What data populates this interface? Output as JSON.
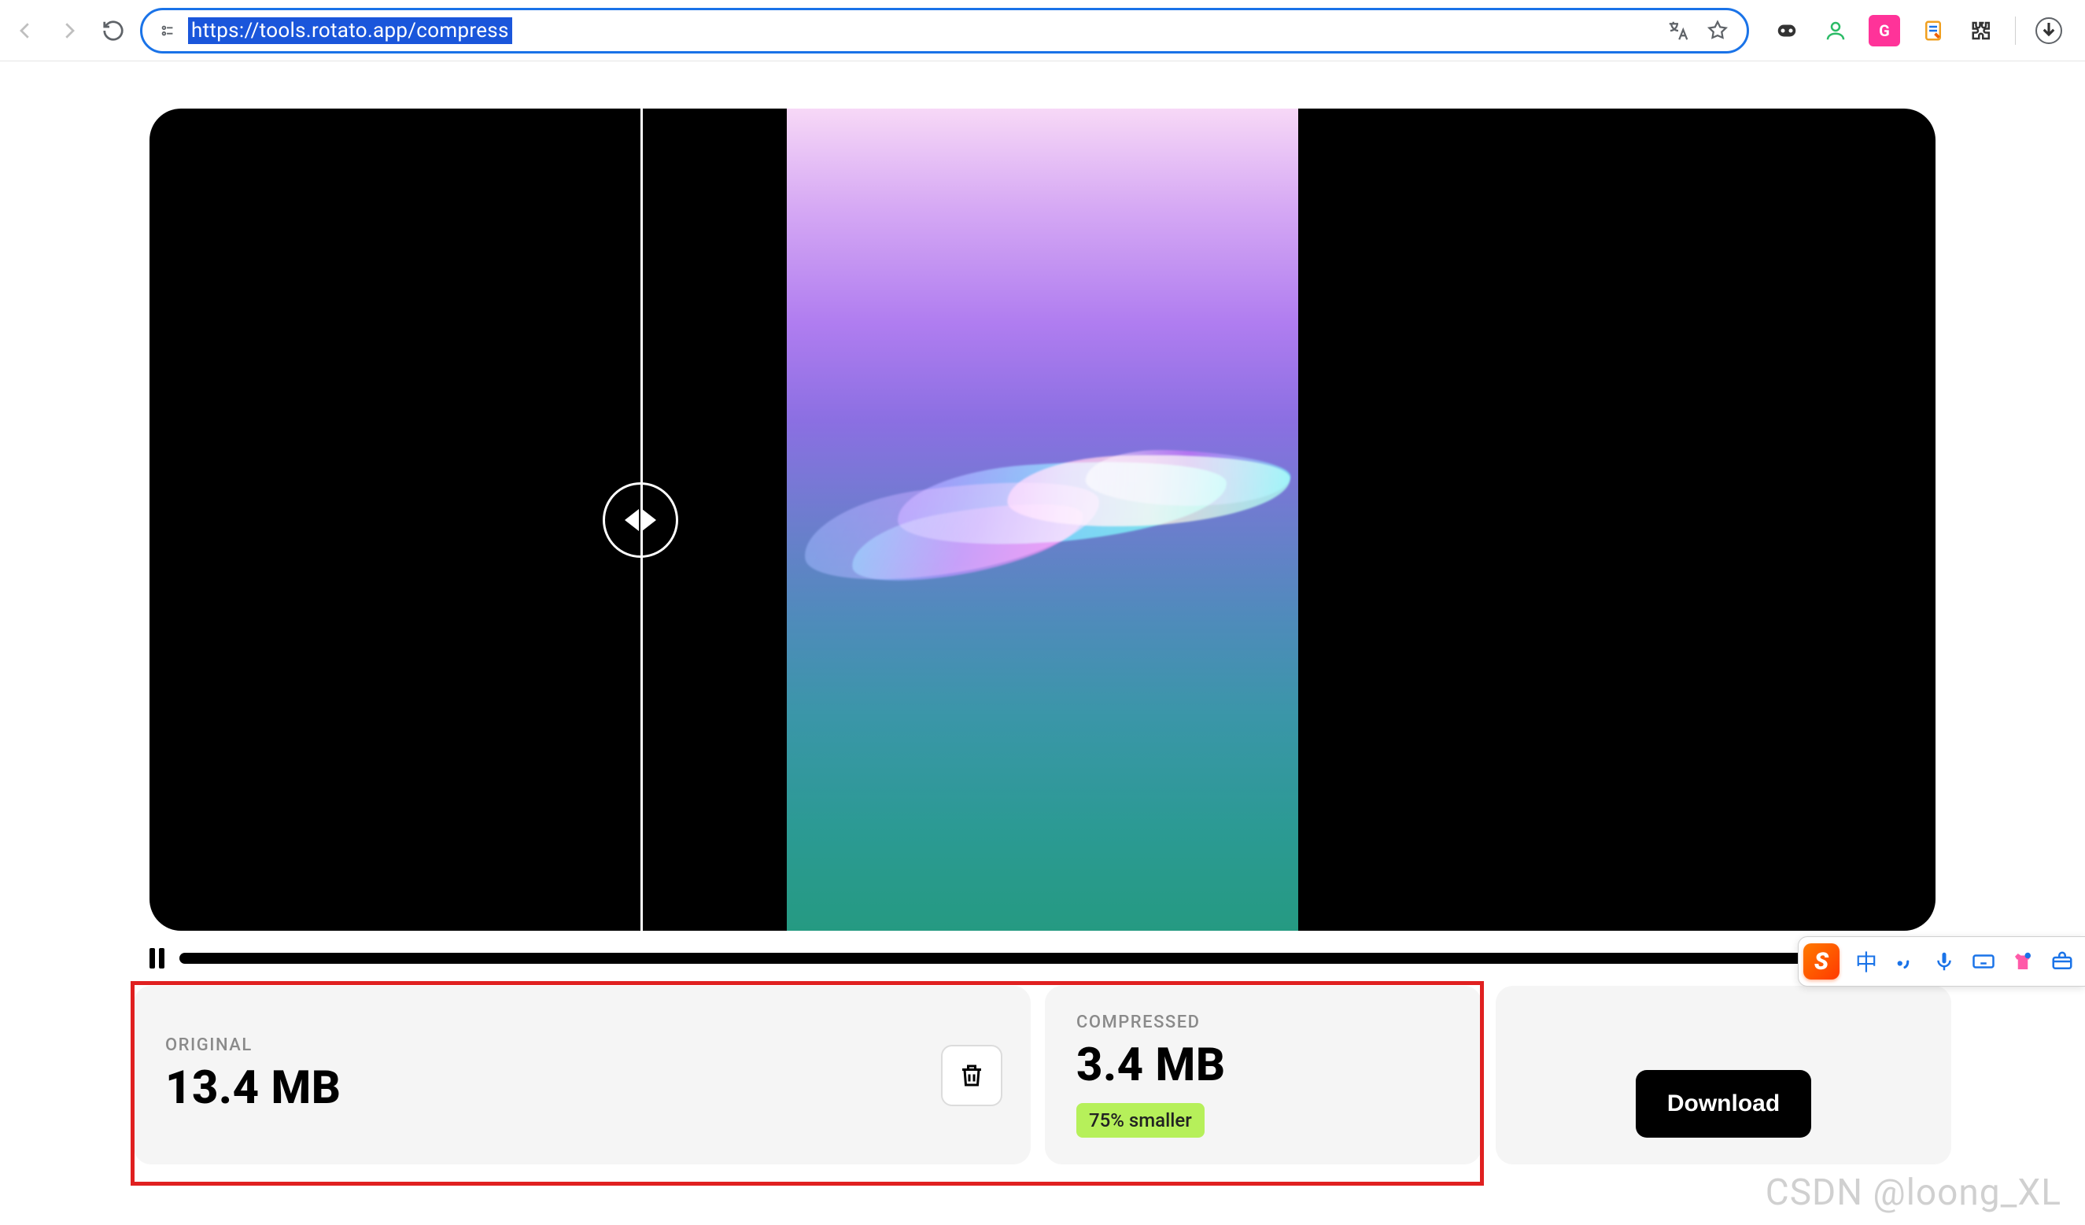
{
  "browser": {
    "url": "https://tools.rotato.app/compress"
  },
  "ime": {
    "logo_letter": "S",
    "lang": "中"
  },
  "stats": {
    "original": {
      "label": "ORIGINAL",
      "size": "13.4 MB"
    },
    "compressed": {
      "label": "COMPRESSED",
      "size": "3.4 MB",
      "badge": "75% smaller"
    }
  },
  "actions": {
    "download": "Download"
  },
  "watermark": "CSDN @loong_XL"
}
